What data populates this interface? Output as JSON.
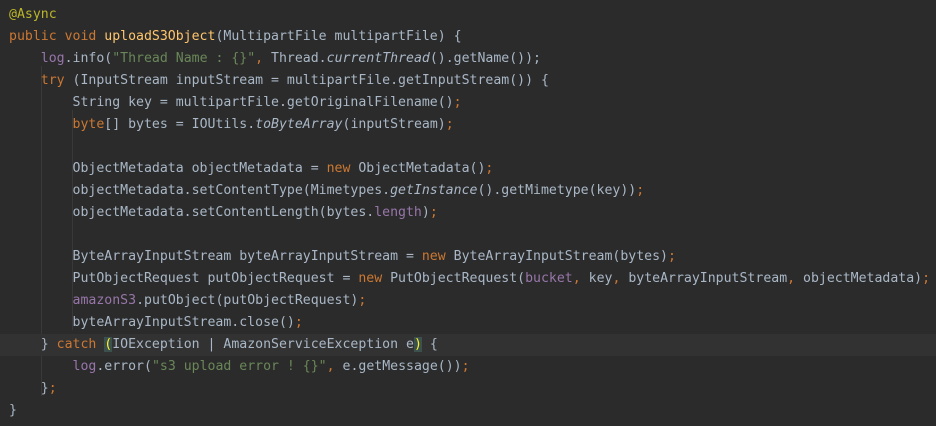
{
  "editor": {
    "lines": [
      {
        "current": false,
        "tokens": [
          [
            "ann",
            "@Async"
          ]
        ]
      },
      {
        "current": false,
        "tokens": [
          [
            "kw",
            "public void "
          ],
          [
            "fn",
            "uploadS3Object"
          ],
          [
            "plain",
            "(MultipartFile multipartFile) {"
          ]
        ]
      },
      {
        "current": false,
        "tokens": [
          [
            "plain",
            "    "
          ],
          [
            "field",
            "log"
          ],
          [
            "plain",
            ".info("
          ],
          [
            "str",
            "\"Thread Name : {}\""
          ],
          [
            "punct",
            ", "
          ],
          [
            "plain",
            "Thread."
          ],
          [
            "it",
            "currentThread"
          ],
          [
            "plain",
            "().getName());"
          ]
        ]
      },
      {
        "current": false,
        "tokens": [
          [
            "plain",
            "    "
          ],
          [
            "kw",
            "try "
          ],
          [
            "plain",
            "(InputStream inputStream = multipartFile.getInputStream()) {"
          ]
        ]
      },
      {
        "current": false,
        "tokens": [
          [
            "plain",
            "        String key = multipartFile.getOriginalFilename()"
          ],
          [
            "punct",
            ";"
          ]
        ]
      },
      {
        "current": false,
        "tokens": [
          [
            "plain",
            "        "
          ],
          [
            "kw",
            "byte"
          ],
          [
            "plain",
            "[] bytes = IOUtils."
          ],
          [
            "it",
            "toByteArray"
          ],
          [
            "plain",
            "(inputStream)"
          ],
          [
            "punct",
            ";"
          ]
        ]
      },
      {
        "current": false,
        "tokens": []
      },
      {
        "current": false,
        "tokens": [
          [
            "plain",
            "        ObjectMetadata objectMetadata = "
          ],
          [
            "kw",
            "new "
          ],
          [
            "plain",
            "ObjectMetadata()"
          ],
          [
            "punct",
            ";"
          ]
        ]
      },
      {
        "current": false,
        "tokens": [
          [
            "plain",
            "        objectMetadata.setContentType(Mimetypes."
          ],
          [
            "it",
            "getInstance"
          ],
          [
            "plain",
            "().getMimetype(key))"
          ],
          [
            "punct",
            ";"
          ]
        ]
      },
      {
        "current": false,
        "tokens": [
          [
            "plain",
            "        objectMetadata.setContentLength(bytes."
          ],
          [
            "field",
            "length"
          ],
          [
            "plain",
            ")"
          ],
          [
            "punct",
            ";"
          ]
        ]
      },
      {
        "current": false,
        "tokens": []
      },
      {
        "current": false,
        "tokens": [
          [
            "plain",
            "        ByteArrayInputStream byteArrayInputStream = "
          ],
          [
            "kw",
            "new "
          ],
          [
            "plain",
            "ByteArrayInputStream(bytes)"
          ],
          [
            "punct",
            ";"
          ]
        ]
      },
      {
        "current": false,
        "tokens": [
          [
            "plain",
            "        PutObjectRequest putObjectRequest = "
          ],
          [
            "kw",
            "new "
          ],
          [
            "plain",
            "PutObjectRequest("
          ],
          [
            "field",
            "bucket"
          ],
          [
            "punct",
            ", "
          ],
          [
            "plain",
            "key"
          ],
          [
            "punct",
            ", "
          ],
          [
            "plain",
            "byteArrayInputStream"
          ],
          [
            "punct",
            ", "
          ],
          [
            "plain",
            "objectMetadata)"
          ],
          [
            "punct",
            ";"
          ]
        ]
      },
      {
        "current": false,
        "tokens": [
          [
            "plain",
            "        "
          ],
          [
            "field",
            "amazonS3"
          ],
          [
            "plain",
            ".putObject(putObjectRequest)"
          ],
          [
            "punct",
            ";"
          ]
        ]
      },
      {
        "current": false,
        "tokens": [
          [
            "plain",
            "        byteArrayInputStream.close()"
          ],
          [
            "punct",
            ";"
          ]
        ]
      },
      {
        "current": true,
        "tokens": [
          [
            "plain",
            "    } "
          ],
          [
            "kw",
            "catch "
          ],
          [
            "hl",
            "("
          ],
          [
            "plain",
            "IOException | AmazonServiceException e"
          ],
          [
            "hl",
            ")"
          ],
          [
            "plain",
            " {"
          ]
        ]
      },
      {
        "current": false,
        "tokens": [
          [
            "plain",
            "        "
          ],
          [
            "field",
            "log"
          ],
          [
            "plain",
            ".error("
          ],
          [
            "str",
            "\"s3 upload error ! {}\""
          ],
          [
            "punct",
            ", "
          ],
          [
            "plain",
            "e.getMessage())"
          ],
          [
            "punct",
            ";"
          ]
        ]
      },
      {
        "current": false,
        "tokens": [
          [
            "plain",
            "    }"
          ],
          [
            "punct",
            ";"
          ]
        ]
      },
      {
        "current": false,
        "tokens": [
          [
            "plain",
            "}"
          ]
        ]
      }
    ]
  }
}
